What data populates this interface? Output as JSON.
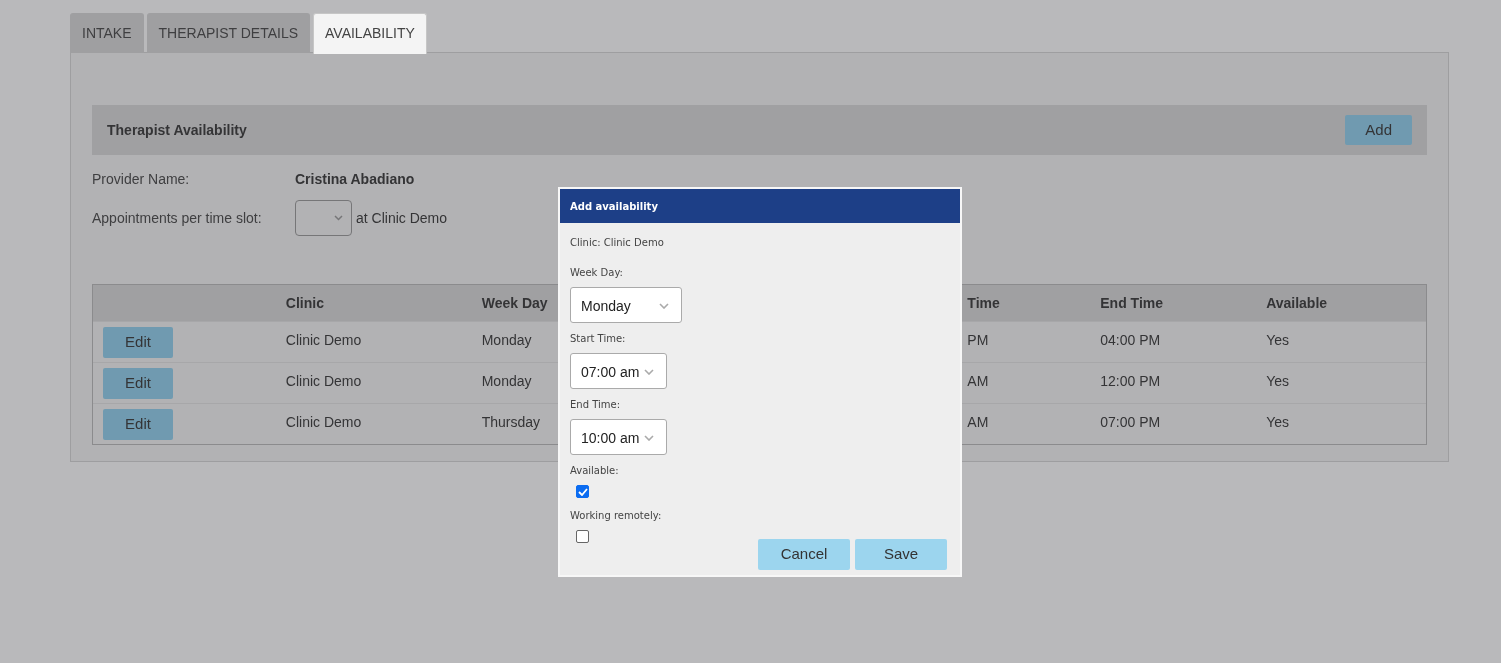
{
  "tabs": [
    {
      "label": "INTAKE",
      "selected": false
    },
    {
      "label": "THERAPIST DETAILS",
      "selected": false
    },
    {
      "label": "AVAILABILITY",
      "selected": true
    }
  ],
  "section": {
    "title": "Therapist Availability",
    "add_button": "Add"
  },
  "provider": {
    "label": "Provider Name:",
    "value": "Cristina Abadiano"
  },
  "appointments": {
    "label": "Appointments per time slot:",
    "suffix": "at Clinic Demo"
  },
  "table": {
    "columns": [
      "Clinic",
      "Week Day",
      "Time",
      "End Time",
      "Available"
    ],
    "rows": [
      {
        "action": "Edit",
        "cells": [
          "Clinic Demo",
          "Monday",
          "PM",
          "04:00 PM",
          "Yes"
        ]
      },
      {
        "action": "Edit",
        "cells": [
          "Clinic Demo",
          "Monday",
          "AM",
          "12:00 PM",
          "Yes"
        ]
      },
      {
        "action": "Edit",
        "cells": [
          "Clinic Demo",
          "Thursday",
          "AM",
          "07:00 PM",
          "Yes"
        ]
      }
    ]
  },
  "dialog": {
    "title": "Add availability",
    "clinic": "Clinic: Clinic Demo",
    "fields": [
      {
        "kind": "select",
        "label": "Week Day:",
        "value": "Monday"
      },
      {
        "kind": "select",
        "label": "Start Time:",
        "value": "07:00 am"
      },
      {
        "kind": "select",
        "label": "End Time:",
        "value": "10:00 am"
      },
      {
        "kind": "checkbox",
        "label": "Available:",
        "checked": true
      },
      {
        "kind": "checkbox",
        "label": "Working remotely:",
        "checked": false
      }
    ],
    "buttons": [
      "Cancel",
      "Save"
    ]
  }
}
